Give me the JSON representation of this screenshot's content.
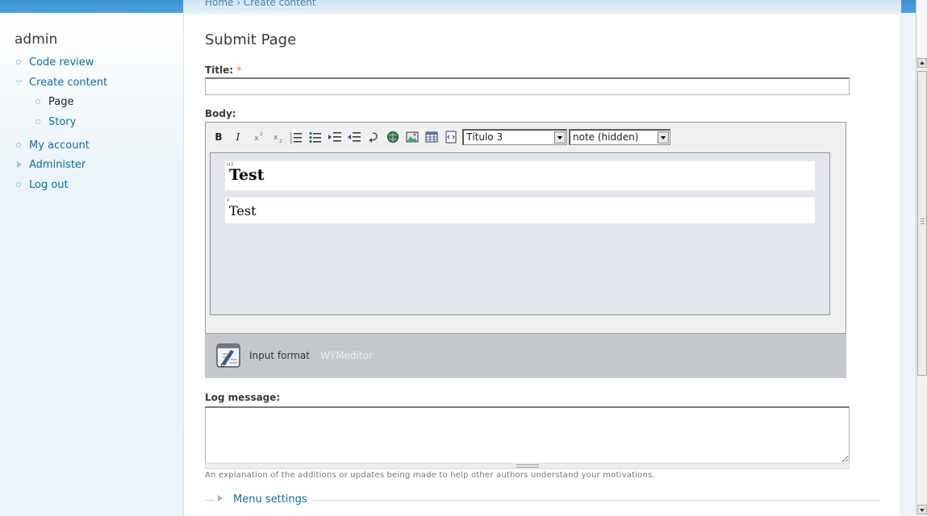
{
  "breadcrumb": {
    "home": "Home",
    "separator": "›",
    "current": "Create content"
  },
  "sidebar": {
    "title": "admin",
    "items": [
      {
        "label": "Code review"
      },
      {
        "label": "Create content"
      },
      {
        "label": "Page"
      },
      {
        "label": "Story"
      },
      {
        "label": "My account"
      },
      {
        "label": "Administer"
      },
      {
        "label": "Log out"
      }
    ]
  },
  "page": {
    "title": "Submit Page"
  },
  "form": {
    "title_label": "Title:",
    "required_mark": "*",
    "title_value": "",
    "body_label": "Body:",
    "log_label": "Log message:",
    "log_value": "",
    "log_help": "An explanation of the additions or updates being made to help other authors understand your motivations.",
    "menu_settings": "Menu settings"
  },
  "editor": {
    "toolbar": {
      "bold": "B",
      "italic": "I"
    },
    "container_select": "Título 3",
    "class_select": "note (hidden)",
    "content": [
      {
        "tag": "H3",
        "text": "Test"
      },
      {
        "tag": "P",
        "text": "Test"
      }
    ],
    "format_label": "Input format",
    "format_value": "WYMeditor"
  },
  "colors": {
    "link": "#0a6ea9",
    "top_band": "#3c91cf",
    "format_bar": "#c5c8cc"
  }
}
